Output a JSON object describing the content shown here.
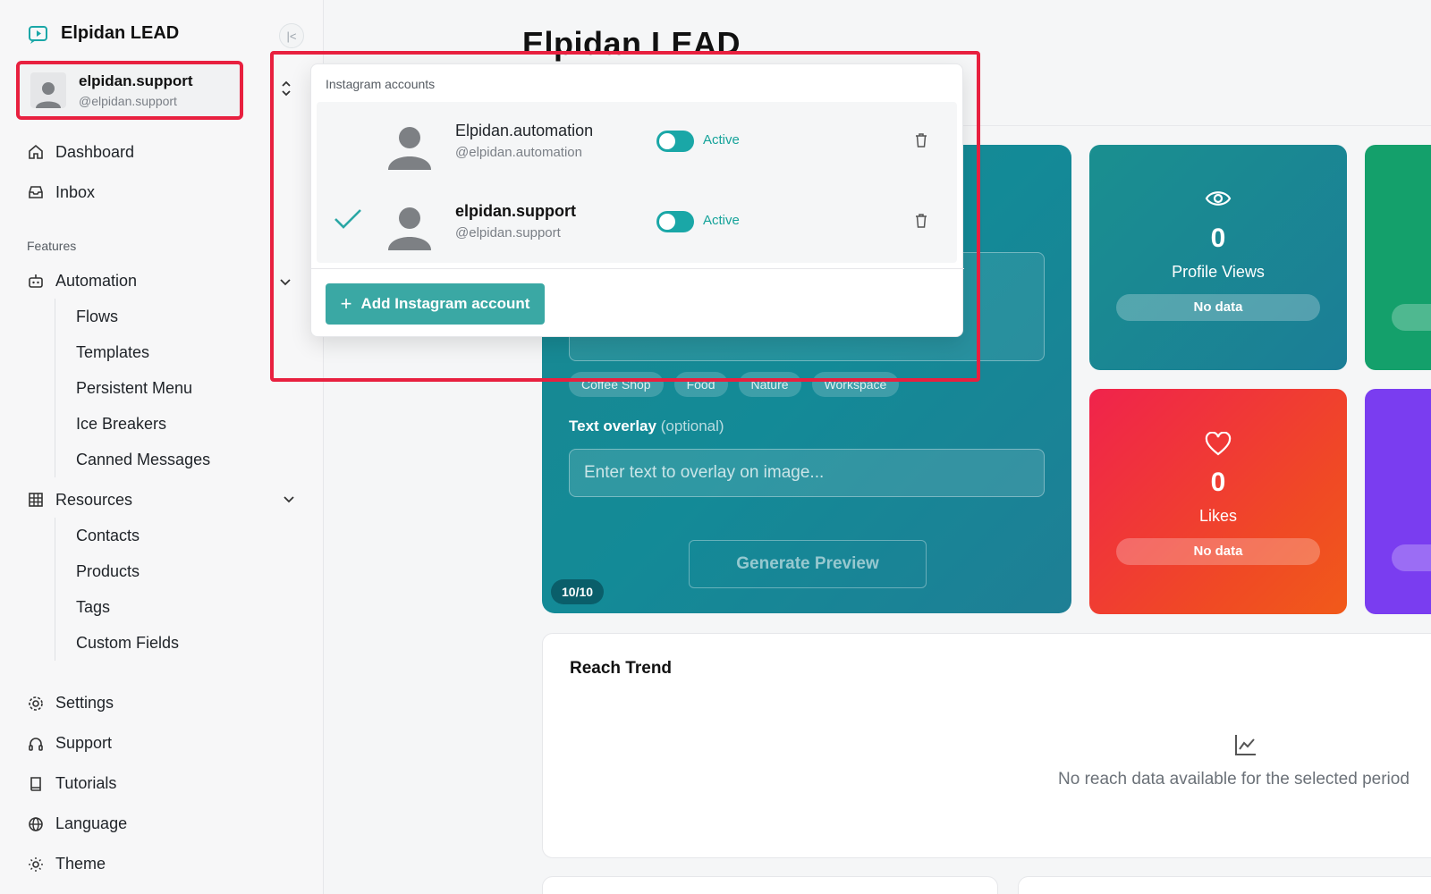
{
  "brand": {
    "name": "Elpidan LEAD"
  },
  "current_account": {
    "name": "elpidan.support",
    "handle": "@elpidan.support"
  },
  "nav": {
    "dashboard": "Dashboard",
    "inbox": "Inbox",
    "features_label": "Features",
    "automation": "Automation",
    "automation_items": [
      "Flows",
      "Templates",
      "Persistent Menu",
      "Ice Breakers",
      "Canned Messages"
    ],
    "resources": "Resources",
    "resources_items": [
      "Contacts",
      "Products",
      "Tags",
      "Custom Fields"
    ],
    "settings": "Settings",
    "support": "Support",
    "tutorials": "Tutorials",
    "language": "Language",
    "theme": "Theme"
  },
  "page": {
    "title": "Elpidan LEAD"
  },
  "ai_card": {
    "chips": [
      "Coffee Shop",
      "Food",
      "Nature",
      "Workspace"
    ],
    "overlay_label": "Text overlay",
    "overlay_optional": "(optional)",
    "overlay_placeholder": "Enter text to overlay on image...",
    "generate_label": "Generate Preview",
    "counter": "10/10"
  },
  "stats": {
    "views": {
      "value": "0",
      "label": "Profile Views",
      "pill": "No data"
    },
    "likes": {
      "value": "0",
      "label": "Likes",
      "pill": "No data"
    }
  },
  "reach": {
    "title": "Reach Trend",
    "empty": "No reach data available for the selected period"
  },
  "switcher": {
    "heading": "Instagram accounts",
    "accounts": [
      {
        "name": "Elpidan.automation",
        "handle": "@elpidan.automation",
        "status": "Active",
        "selected": false
      },
      {
        "name": "elpidan.support",
        "handle": "@elpidan.support",
        "status": "Active",
        "selected": true
      }
    ],
    "add_label": "Add Instagram account"
  },
  "colors": {
    "accent": "#1aa7a7",
    "highlight": "#e8203f",
    "likes": "#f0234c",
    "views": "#1a8f90"
  }
}
